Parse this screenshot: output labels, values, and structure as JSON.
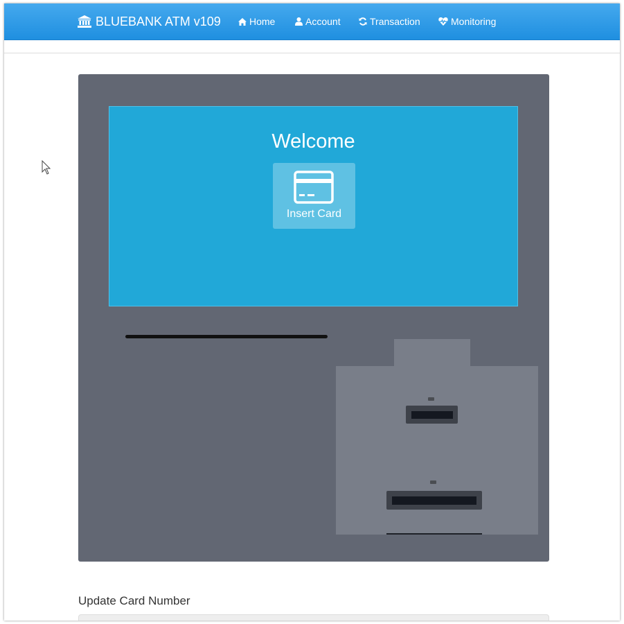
{
  "navbar": {
    "brand_icon": "bank-icon",
    "brand": "BLUEBANK ATM v109",
    "items": [
      {
        "label": "Home",
        "icon": "home-icon"
      },
      {
        "label": "Account",
        "icon": "user-icon"
      },
      {
        "label": "Transaction",
        "icon": "refresh-icon"
      },
      {
        "label": "Monitoring",
        "icon": "heartbeat-icon"
      }
    ],
    "color": "#2e9be6"
  },
  "atm": {
    "body_color": "#626773",
    "screen_color": "#21a8d8",
    "panel_color": "#797e89",
    "screen": {
      "title": "Welcome",
      "button_label": "Insert Card",
      "button_icon": "credit-card-icon"
    }
  },
  "form": {
    "label": "Update Card Number",
    "value": ""
  }
}
